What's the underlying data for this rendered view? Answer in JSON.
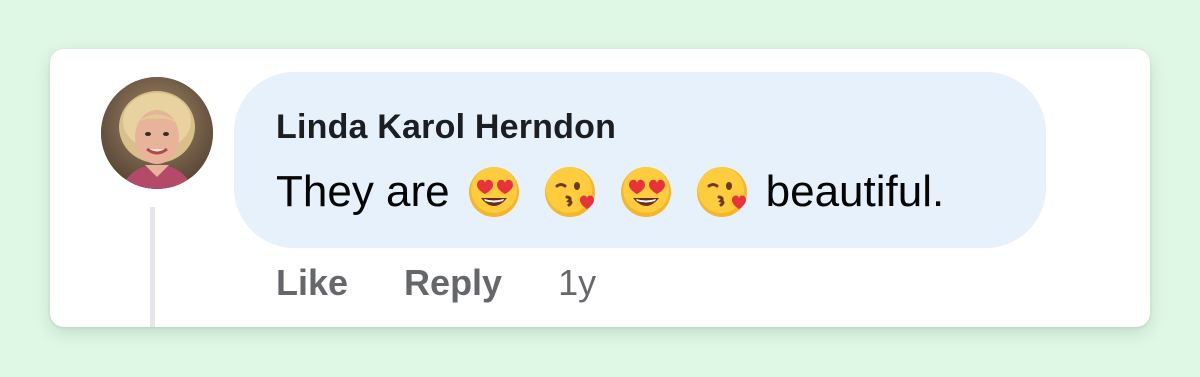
{
  "comment": {
    "author": "Linda Karol Herndon",
    "text_before": "They are",
    "text_after": "beautiful.",
    "emojis": [
      "heart-eyes-emoji",
      "kissing-heart-emoji",
      "heart-eyes-emoji",
      "kissing-heart-emoji"
    ],
    "timestamp": "1y"
  },
  "actions": {
    "like_label": "Like",
    "reply_label": "Reply"
  },
  "colors": {
    "background": "#dff8e6",
    "bubble": "#e6f1fc",
    "action_text": "#65676b"
  }
}
